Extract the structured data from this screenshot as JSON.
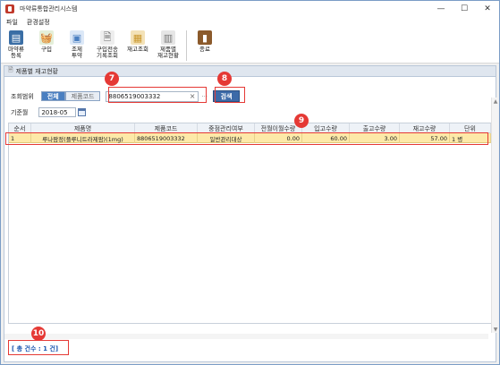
{
  "window": {
    "title": "마약류통합관리시스템",
    "controls": {
      "minimize": "—",
      "maximize": "☐",
      "close": "✕"
    }
  },
  "menu": [
    "파일",
    "환경설정"
  ],
  "toolbar": [
    {
      "label": "마약류\n등록",
      "icon": "register-icon",
      "color": "#3a6ea5"
    },
    {
      "label": "구입",
      "icon": "basket-icon",
      "color": "#5b8c3e"
    },
    {
      "label": "조제\n투약",
      "icon": "dispense-icon",
      "color": "#4a7fc1"
    },
    {
      "label": "구입전송\n기록조회",
      "icon": "purchase-log-icon",
      "color": "#6a6a6a"
    },
    {
      "label": "재고조회",
      "icon": "stock-icon",
      "color": "#c9962b"
    },
    {
      "label": "제품별\n재고현황",
      "icon": "product-stock-icon",
      "color": "#777"
    },
    {
      "label": "종료",
      "icon": "exit-icon",
      "color": "#8b5a2b"
    }
  ],
  "panel": {
    "title": "제품별 재고현황"
  },
  "filter": {
    "scope_label": "조회범위",
    "scope_all": "전체",
    "scope_code": "제품코드",
    "code_value": "8806519003332",
    "dots": "···",
    "search_label": "검색",
    "month_label": "기준월",
    "month_value": "2018-05"
  },
  "grid": {
    "columns": [
      "순서",
      "제품명",
      "제품코드",
      "중점관리여부",
      "전월이월수량",
      "입고수량",
      "출고수량",
      "재고수량",
      "단위"
    ],
    "rows": [
      [
        "1",
        "루나팜정(플루니트라제팜)(1mg)",
        "8806519003332",
        "일반관리대상",
        "0.00",
        "60.00",
        "3.00",
        "57.00",
        "1 병"
      ]
    ]
  },
  "total_text": "[ 총 건수 : 1 건]",
  "annotations": [
    "7",
    "8",
    "9",
    "10"
  ],
  "colors": {
    "accent": "#4a7fc1",
    "highlight_row": "#fde9a8",
    "annotation": "#e53935"
  }
}
